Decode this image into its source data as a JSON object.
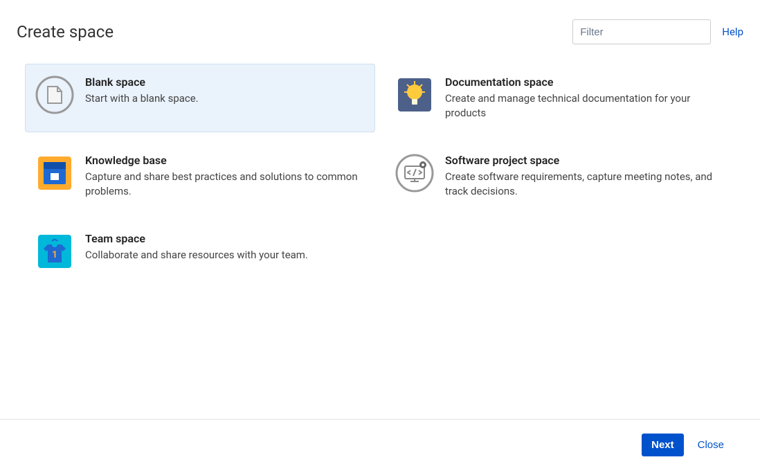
{
  "header": {
    "title": "Create space",
    "filter_placeholder": "Filter",
    "help": "Help"
  },
  "options": {
    "blank": {
      "title": "Blank space",
      "desc": "Start with a blank space."
    },
    "documentation": {
      "title": "Documentation space",
      "desc": "Create and manage technical documentation for your products"
    },
    "knowledge": {
      "title": "Knowledge base",
      "desc": "Capture and share best practices and solutions to common problems."
    },
    "software": {
      "title": "Software project space",
      "desc": "Create software requirements, capture meeting notes, and track decisions."
    },
    "team": {
      "title": "Team space",
      "desc": "Collaborate and share resources with your team."
    }
  },
  "footer": {
    "next": "Next",
    "close": "Close"
  }
}
